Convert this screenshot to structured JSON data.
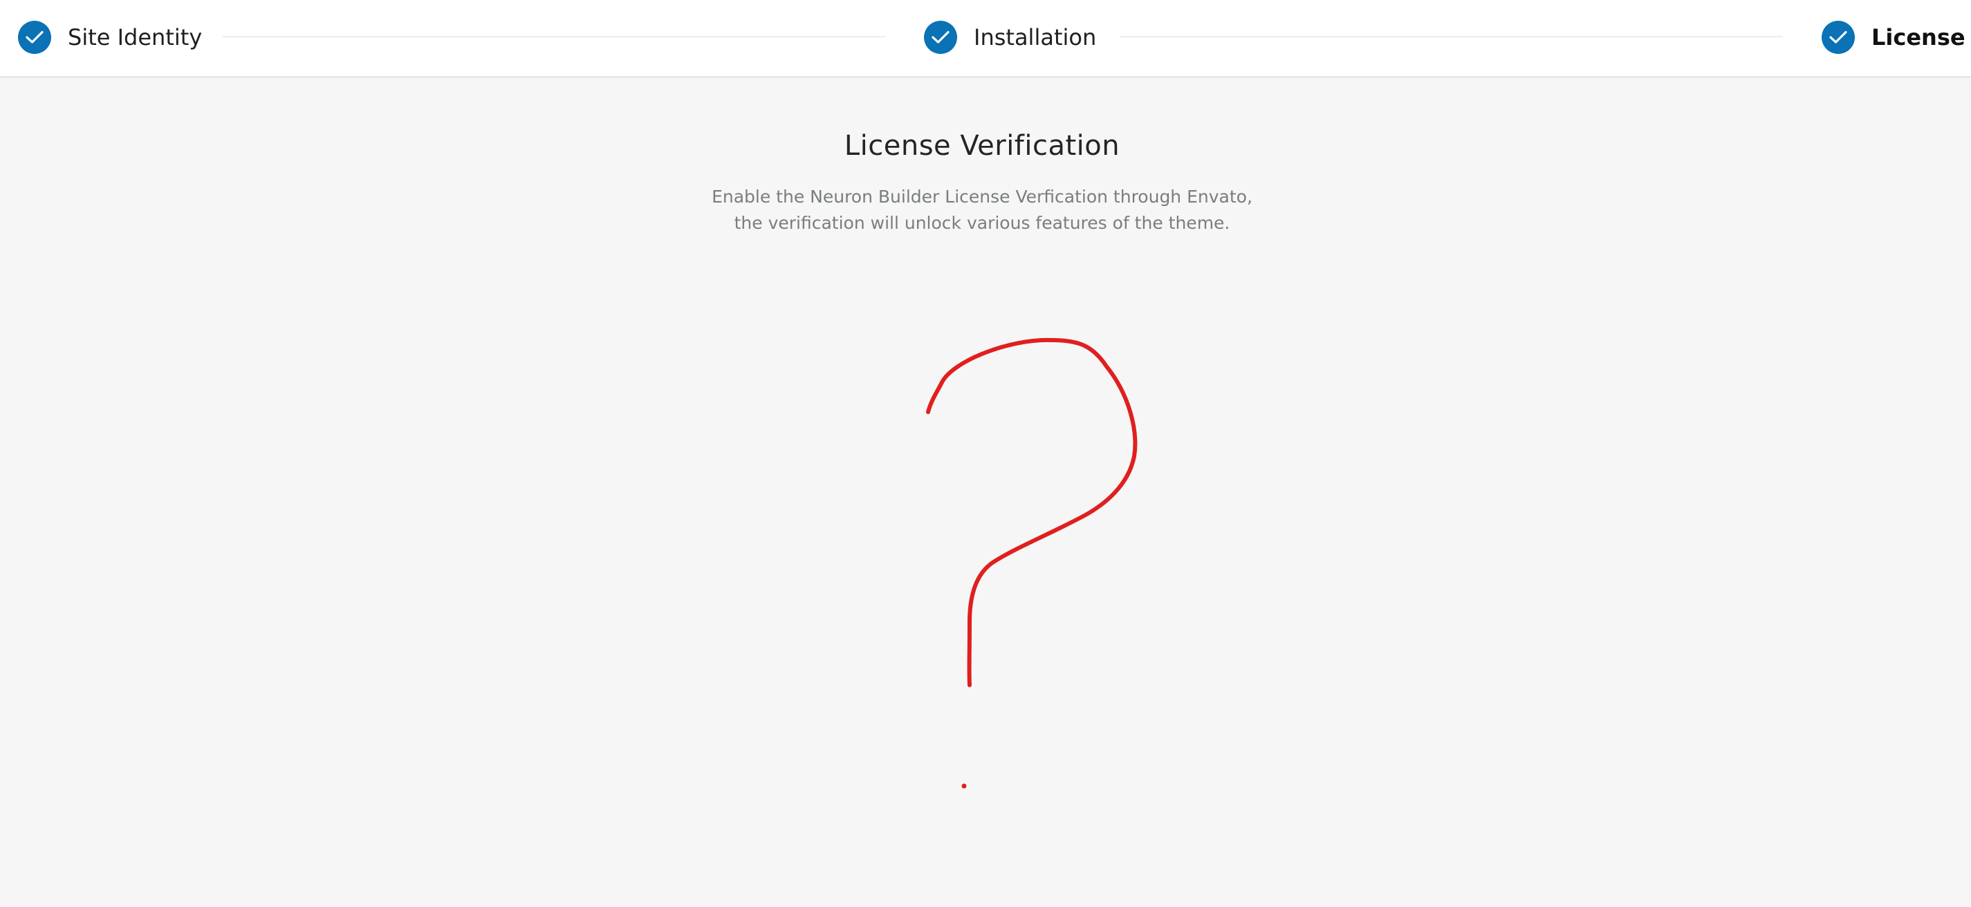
{
  "stepper": {
    "steps": [
      {
        "label": "Site Identity",
        "status": "complete"
      },
      {
        "label": "Installation",
        "status": "complete"
      },
      {
        "label": "License",
        "status": "current"
      }
    ],
    "check_color": "#0a72b5"
  },
  "main": {
    "title": "License Verification",
    "description_line1": "Enable the Neuron Builder License Verfication through Envato,",
    "description_line2": "the verification will unlock various features of the theme."
  },
  "annotation": {
    "shape": "hand-drawn-question-mark",
    "color": "#e01f1f"
  }
}
